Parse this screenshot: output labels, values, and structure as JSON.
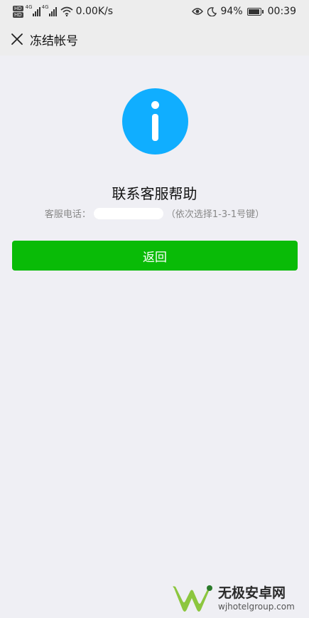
{
  "status_bar": {
    "hd_badges": [
      "HD",
      "HD"
    ],
    "signal_tags": [
      "4G",
      "4G"
    ],
    "net_speed": "0.00K/s",
    "battery_percent": "94%",
    "time": "00:39",
    "icons": [
      "eye-icon",
      "moon-icon",
      "battery-icon",
      "wifi-icon",
      "signal-icon"
    ]
  },
  "nav": {
    "title": "冻结帐号",
    "close_icon": "close-icon"
  },
  "main": {
    "info_icon": "info-icon",
    "info_color": "#10aeff",
    "heading": "联系客服帮助",
    "phone_label": "客服电话：",
    "phone_hint": "（依次选择1-3-1号键）"
  },
  "actions": {
    "return_label": "返回",
    "return_color": "#09bb07"
  },
  "watermark": {
    "name": "无极安卓网",
    "url": "wjhotelgroup.com"
  }
}
